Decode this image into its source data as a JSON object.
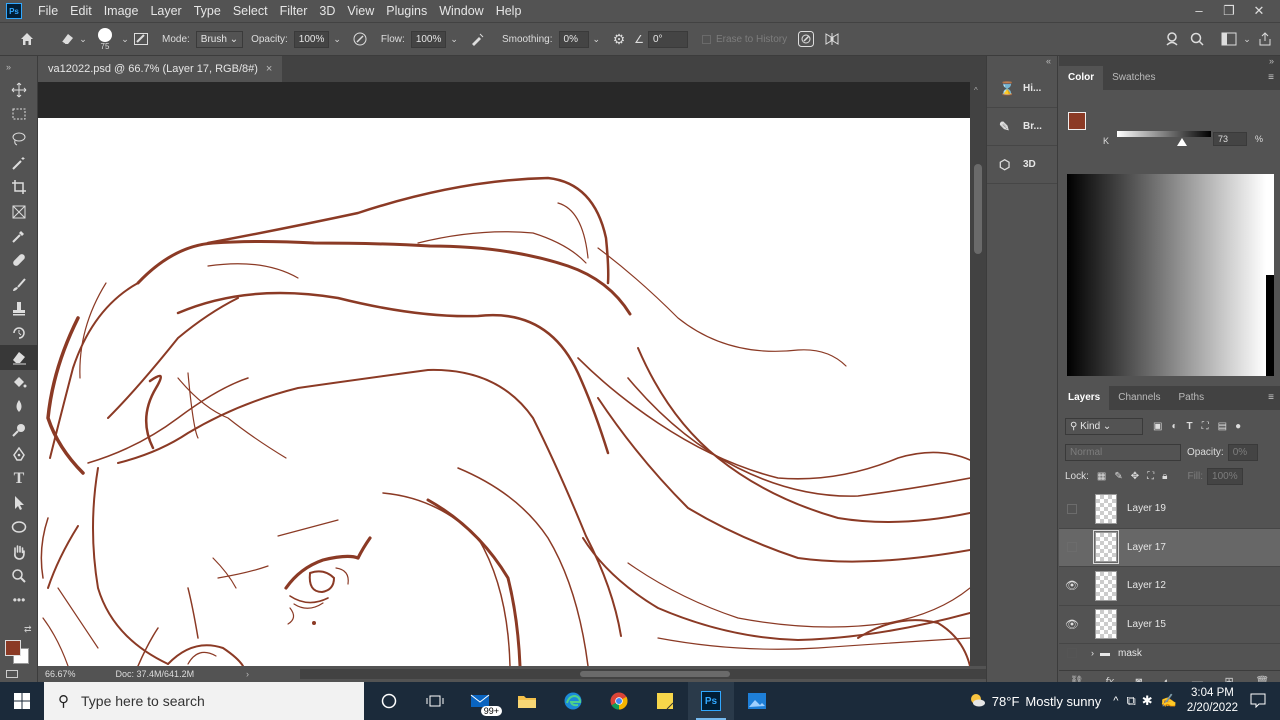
{
  "app": {
    "logo_text": "Ps"
  },
  "menu": [
    "File",
    "Edit",
    "Image",
    "Layer",
    "Type",
    "Select",
    "Filter",
    "3D",
    "View",
    "Plugins",
    "Window",
    "Help"
  ],
  "options": {
    "brush_size": "75",
    "mode_label": "Mode:",
    "mode_value": "Brush",
    "opacity_label": "Opacity:",
    "opacity_value": "100%",
    "flow_label": "Flow:",
    "flow_value": "100%",
    "smoothing_label": "Smoothing:",
    "smoothing_value": "0%",
    "angle_value": "0°",
    "erase_history_label": "Erase to History"
  },
  "document": {
    "tab_title": "va12022.psd @ 66.7% (Layer 17, RGB/8#)",
    "close": "×",
    "zoom": "66.67%",
    "doc_info": "Doc: 37.4M/641.2M"
  },
  "mini_panels": [
    {
      "label": "Hi..."
    },
    {
      "label": "Br..."
    },
    {
      "label": "3D"
    }
  ],
  "color_panel": {
    "tabs": [
      "Color",
      "Swatches"
    ],
    "channel": "K",
    "k_value": "73",
    "pct": "%",
    "fg_color": "#8b3a25"
  },
  "layers_panel": {
    "tabs": [
      "Layers",
      "Channels",
      "Paths"
    ],
    "filter_kind": "Kind",
    "blend_mode": "Normal",
    "opacity_label": "Opacity:",
    "opacity_value": "0%",
    "lock_label": "Lock:",
    "fill_label": "Fill:",
    "fill_value": "100%",
    "layers": [
      {
        "name": "Layer 19",
        "visible": false,
        "selected": false
      },
      {
        "name": "Layer 17",
        "visible": false,
        "selected": true
      },
      {
        "name": "Layer 12",
        "visible": true,
        "selected": false
      },
      {
        "name": "Layer 15",
        "visible": true,
        "selected": false
      }
    ],
    "group_name": "mask"
  },
  "taskbar": {
    "search_placeholder": "Type here to search",
    "mail_badge": "99+",
    "weather_temp": "78°F",
    "weather_text": "Mostly sunny",
    "time": "3:04 PM",
    "date": "2/20/2022"
  },
  "drawing": {
    "line_color": "#8b3a25"
  }
}
